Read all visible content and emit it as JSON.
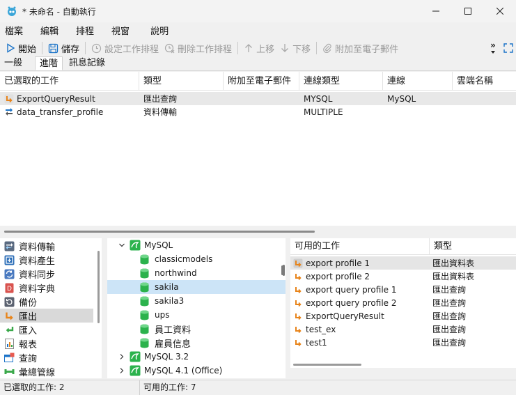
{
  "window": {
    "title": "* 未命名 - 自動執行"
  },
  "menu": [
    "檔案",
    "編輯",
    "排程",
    "視窗",
    "說明"
  ],
  "toolbar": {
    "start": "開始",
    "save": "儲存",
    "set_schedule": "設定工作排程",
    "delete_schedule": "刪除工作排程",
    "move_up": "上移",
    "move_down": "下移",
    "attach_email": "附加至電子郵件",
    "overflow": "»"
  },
  "tabs": [
    "一般",
    "進階",
    "訊息記錄"
  ],
  "job_table": {
    "columns": [
      "已選取的工作",
      "類型",
      "附加至電子郵件",
      "連線類型",
      "連線",
      "雲端名稱"
    ],
    "rows": [
      [
        "ExportQueryResult",
        "匯出查詢",
        "",
        "MYSQL",
        "MySQL",
        ""
      ],
      [
        "data_transfer_profile",
        "資料傳輸",
        "",
        "MULTIPLE",
        "",
        ""
      ]
    ]
  },
  "categories": [
    {
      "label": "資料傳輸",
      "icon": "data-transfer-icon"
    },
    {
      "label": "資料產生",
      "icon": "data-generation-icon"
    },
    {
      "label": "資料同步",
      "icon": "data-sync-icon"
    },
    {
      "label": "資料字典",
      "icon": "data-dictionary-icon"
    },
    {
      "label": "備份",
      "icon": "backup-icon"
    },
    {
      "label": "匯出",
      "icon": "export-icon"
    },
    {
      "label": "匯入",
      "icon": "import-icon"
    },
    {
      "label": "報表",
      "icon": "report-icon"
    },
    {
      "label": "查詢",
      "icon": "query-icon"
    },
    {
      "label": "彙總管線",
      "icon": "aggregation-pipeline-icon"
    }
  ],
  "tree": {
    "root": "MySQL",
    "databases": [
      "classicmodels",
      "northwind",
      "sakila",
      "sakila3",
      "ups",
      "員工資料",
      "雇員信息"
    ],
    "other_connections": [
      "MySQL 3.2",
      "MySQL 4.1 (Office)"
    ]
  },
  "available_jobs": {
    "columns": [
      "可用的工作",
      "類型"
    ],
    "rows": [
      [
        "export profile 1",
        "匯出資料表"
      ],
      [
        "export profile 2",
        "匯出資料表"
      ],
      [
        "export query profile 1",
        "匯出查詢"
      ],
      [
        "export query profile 2",
        "匯出查詢"
      ],
      [
        "ExportQueryResult",
        "匯出查詢"
      ],
      [
        "test_ex",
        "匯出查詢"
      ],
      [
        "test1",
        "匯出查詢"
      ]
    ]
  },
  "status": {
    "selected_jobs": "已選取的工作: 2",
    "available_jobs": "可用的工作: 7"
  },
  "colors": {
    "accent_blue": "#1a73c8",
    "mysql_green": "#2bb24c",
    "export_orange": "#e8841a",
    "selection_blue": "#cce4f7"
  }
}
